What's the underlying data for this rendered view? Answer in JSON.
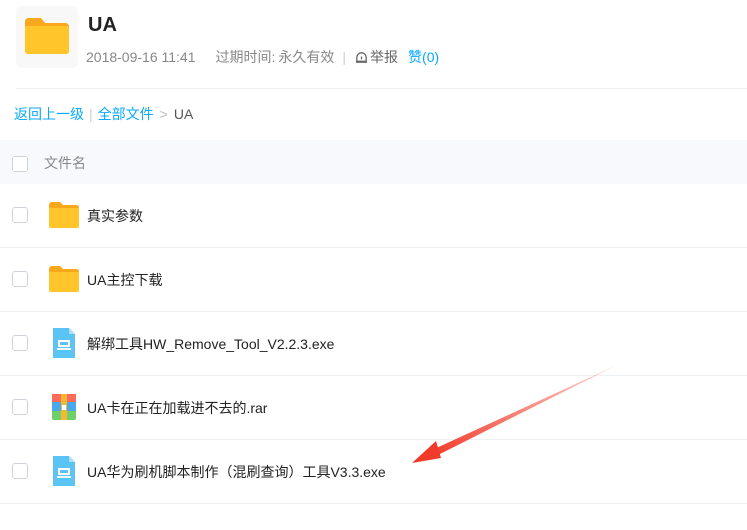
{
  "header": {
    "title": "UA",
    "date": "2018-09-16 11:41",
    "expire_label": "过期时间:",
    "expire_value": "永久有效",
    "report_label": "举报",
    "like_label": "赞(0)"
  },
  "breadcrumb": {
    "back": "返回上一级",
    "all_files": "全部文件",
    "separator": ">",
    "current": "UA"
  },
  "table": {
    "column_name": "文件名",
    "rows": [
      {
        "name": "真实参数",
        "icon": "folder-icon"
      },
      {
        "name": "UA主控下载",
        "icon": "folder-icon"
      },
      {
        "name": "解绑工具HW_Remove_Tool_V2.2.3.exe",
        "icon": "exe-file-icon"
      },
      {
        "name": "UA卡在正在加载进不去的.rar",
        "icon": "archive-file-icon"
      },
      {
        "name": "UA华为刷机脚本制作（混刷查询）工具V3.3.exe",
        "icon": "exe-file-icon"
      }
    ]
  },
  "colors": {
    "accent": "#06a7ff",
    "folder": "#ffc52b",
    "annotation_arrow": "#f23a2a"
  }
}
